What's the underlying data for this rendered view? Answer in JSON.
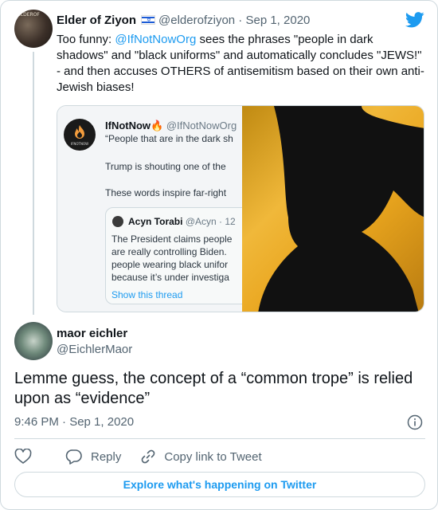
{
  "parent_tweet": {
    "avatar_label": "ELDEROF",
    "name": "Elder of Ziyon",
    "handle": "@elderofziyon",
    "separator": "·",
    "date": "Sep 1, 2020",
    "text_pre": "Too funny: ",
    "mention": "@IfNotNowOrg",
    "text_post": " sees the phrases \"people in dark shadows\" and \"black uniforms\" and automatically concludes \"JEWS!\" - and then accuses OTHERS of antisemitism based on their own anti-Jewish biases!"
  },
  "embedded_screenshot": {
    "account_name": "IfNotNow🔥",
    "account_handle": "@IfNotNowOrg",
    "line1": "“People that are in the dark sh",
    "line2": "Trump is shouting one of the",
    "line3": "These words inspire far-right",
    "logo_label": "IFNOTNOW",
    "quoted": {
      "name": "Acyn Torabi",
      "handle": "@Acyn · 12",
      "line1": "The President claims people",
      "line2": "are really controlling Biden.",
      "line3": "people wearing black unifor",
      "line4": "because it’s under investiga",
      "link": "Show this thread"
    }
  },
  "reply_tweet": {
    "name": "maor eichler",
    "handle": "@EichlerMaor",
    "text": "Lemme guess, the concept of a “common trope” is relied upon as “evidence”",
    "time": "9:46 PM · Sep 1, 2020"
  },
  "actions": {
    "reply_label": "Reply",
    "copy_label": "Copy link to Tweet"
  },
  "explore_label": "Explore what's happening on Twitter",
  "colors": {
    "accent": "#1d9bf0",
    "text": "#0f1419",
    "muted": "#536471",
    "border": "#cfd9de"
  }
}
